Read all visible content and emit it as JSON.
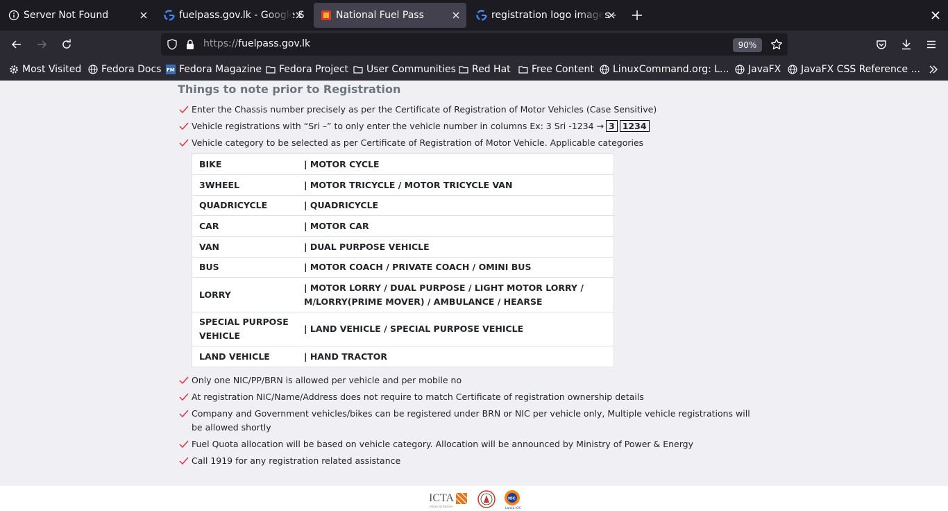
{
  "browser": {
    "tabs": [
      {
        "title": "Server Not Found",
        "icon": "info-icon"
      },
      {
        "title": "fuelpass.gov.lk - Google S",
        "icon": "google-icon"
      },
      {
        "title": "National Fuel Pass",
        "icon": "fuelpass-icon"
      },
      {
        "title": "registration logo images -",
        "icon": "google-icon"
      }
    ],
    "url_proto": "https://",
    "url_host": "fuelpass.gov.lk",
    "zoom": "90%",
    "bookmarks": [
      {
        "label": "Most Visited",
        "icon": "gear-icon"
      },
      {
        "label": "Fedora Docs",
        "icon": "globe-icon"
      },
      {
        "label": "Fedora Magazine",
        "icon": "fedora-magazine-icon"
      },
      {
        "label": "Fedora Project",
        "icon": "folder-icon"
      },
      {
        "label": "User Communities",
        "icon": "folder-icon"
      },
      {
        "label": "Red Hat",
        "icon": "folder-icon"
      },
      {
        "label": "Free Content",
        "icon": "folder-icon"
      },
      {
        "label": "LinuxCommand.org: L...",
        "icon": "globe-icon"
      },
      {
        "label": "JavaFX",
        "icon": "globe-icon"
      },
      {
        "label": "JavaFX CSS Reference ...",
        "icon": "globe-icon"
      }
    ]
  },
  "page": {
    "heading": "Things to note prior to Registration",
    "notes_top": [
      "Enter the Chassis number precisely as per the Certificate of Registration of Motor Vehicles (Case Sensitive)",
      "Vehicle registrations with “Sri –” to only enter the vehicle number in columns Ex: 3 Sri -1234 →",
      "Vehicle category to be selected as per Certificate of Registration of Motor Vehicle. Applicable categories"
    ],
    "example_boxes": [
      "3",
      "1234"
    ],
    "categories": [
      {
        "name": "BIKE",
        "desc": "| MOTOR CYCLE"
      },
      {
        "name": "3WHEEL",
        "desc": "| MOTOR TRICYCLE / MOTOR TRICYCLE VAN"
      },
      {
        "name": "QUADRICYCLE",
        "desc": "| QUADRICYCLE"
      },
      {
        "name": "CAR",
        "desc": "| MOTOR CAR"
      },
      {
        "name": "VAN",
        "desc": "| DUAL PURPOSE VEHICLE"
      },
      {
        "name": "BUS",
        "desc": "| MOTOR COACH / PRIVATE COACH / OMINI BUS"
      },
      {
        "name": "LORRY",
        "desc": "| MOTOR LORRY / DUAL PURPOSE / LIGHT MOTOR LORRY / M/LORRY(PRIME MOVER) / AMBULANCE / HEARSE"
      },
      {
        "name": "SPECIAL PURPOSE VEHICLE",
        "desc": "| LAND VEHICLE / SPECIAL PURPOSE VEHICLE"
      },
      {
        "name": "LAND VEHICLE",
        "desc": "| HAND TRACTOR"
      }
    ],
    "notes_bottom": [
      "Only one NIC/PP/BRN is allowed per vehicle and per mobile no",
      "At registration NIC/Name/Address does not require to match Certificate of registration ownership details",
      "Company and Government vehicles/bikes can be registered under BRN or NIC per vehicle only, Multiple vehicle registrations will be allowed shortly",
      "Fuel Quota allocation will be based on vehicle category. Allocation will be announced by Ministry of Power & Energy",
      "Call 1919 for any registration related assistance"
    ]
  },
  "footer": {
    "icta_text": "ICTA",
    "icta_tag": "ideas actioned",
    "ioc_text": "IOC",
    "ioc_tag": "Lanka IOC"
  },
  "colors": {
    "check": "#dc3545",
    "tabbar": "#1c1b22",
    "toolbar": "#2b2a33",
    "page_bg": "#f0f0f4"
  }
}
